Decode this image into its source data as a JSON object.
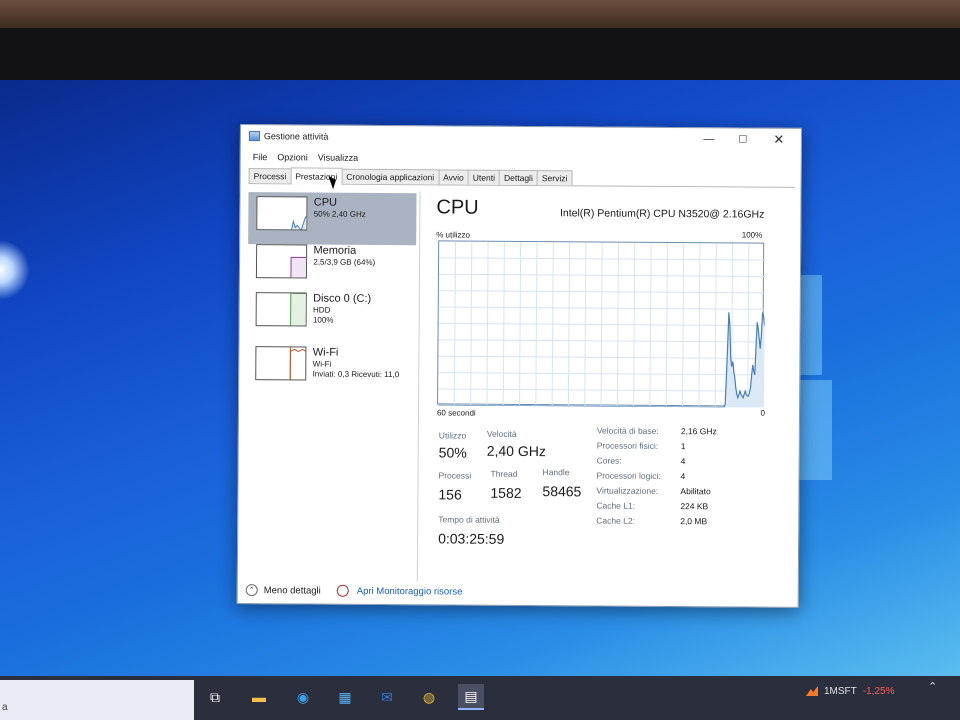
{
  "window": {
    "title": "Gestione attività"
  },
  "menu": [
    "File",
    "Opzioni",
    "Visualizza"
  ],
  "tabs": [
    "Processi",
    "Prestazioni",
    "Cronologia applicazioni",
    "Avvio",
    "Utenti",
    "Dettagli",
    "Servizi"
  ],
  "active_tab": "Prestazioni",
  "resources": [
    {
      "name": "CPU",
      "line1": "50% 2,40 GHz",
      "line2": ""
    },
    {
      "name": "Memoria",
      "line1": "2,5/3,9 GB (64%)",
      "line2": ""
    },
    {
      "name": "Disco 0 (C:)",
      "line1": "HDD",
      "line2": "100%"
    },
    {
      "name": "Wi-Fi",
      "line1": "Wi-Fi",
      "line2": "Inviati: 0,3 Ricevuti: 11,0"
    }
  ],
  "cpu": {
    "title": "CPU",
    "model": "Intel(R) Pentium(R) CPU N3520@ 2.16GHz",
    "util_label": "% utilizzo",
    "max_label": "100%",
    "time_label": "60 secondi",
    "min_label": "0",
    "history_percent": [
      0,
      0,
      0,
      0,
      0,
      0,
      0,
      0,
      0,
      0,
      0,
      0,
      0,
      0,
      0,
      0,
      0,
      0,
      0,
      0,
      0,
      0,
      0,
      0,
      0,
      0,
      0,
      0,
      0,
      0,
      0,
      0,
      0,
      0,
      0,
      0,
      0,
      0,
      0,
      0,
      0,
      0,
      0,
      0,
      0,
      0,
      0,
      0,
      0,
      0,
      0,
      0,
      0,
      0,
      0,
      0,
      0,
      0,
      0,
      0,
      0,
      0,
      0,
      0,
      0,
      0,
      0,
      0,
      0,
      0,
      0,
      0,
      0,
      0,
      0,
      0,
      0,
      0,
      0,
      0,
      0,
      0,
      0,
      0,
      0,
      0,
      0,
      0,
      0,
      0,
      0,
      0,
      0,
      0,
      0,
      0,
      0,
      0,
      0,
      0,
      0,
      0,
      0,
      0,
      0,
      0,
      0,
      0,
      0,
      0,
      0,
      0,
      0,
      0,
      0,
      0,
      0,
      0,
      0,
      0,
      0,
      0,
      0,
      0,
      0,
      0,
      0,
      0,
      0,
      0,
      0,
      0,
      0,
      0,
      0,
      0,
      0,
      0,
      0,
      0,
      0,
      0,
      0,
      0,
      0,
      0,
      0,
      0,
      0,
      0,
      0,
      0,
      0,
      0,
      0,
      0,
      0,
      0,
      0,
      0,
      0,
      0,
      0,
      0,
      0,
      0,
      0,
      0,
      0,
      0,
      0,
      0,
      0,
      0,
      0,
      0,
      0,
      0,
      0,
      0,
      0,
      0,
      0,
      0,
      0,
      0,
      0,
      0,
      0,
      0,
      0,
      0,
      0,
      0,
      0,
      0,
      0,
      0,
      0,
      0,
      0,
      0,
      0,
      0,
      0,
      0,
      0,
      0,
      0,
      0,
      0,
      0,
      0,
      0,
      0,
      0,
      0,
      0,
      0,
      0,
      0,
      0,
      0,
      0,
      0,
      0,
      0,
      0,
      0,
      0,
      0,
      0,
      0,
      0,
      0,
      0,
      0,
      0,
      0,
      0,
      0,
      0,
      0,
      0,
      0,
      0,
      0,
      0,
      0,
      0,
      0,
      0,
      0,
      0,
      0,
      0,
      0,
      0,
      0,
      0,
      0,
      0,
      0,
      0,
      0,
      0,
      0,
      0,
      0,
      0,
      0,
      0,
      0,
      2,
      18,
      38,
      58,
      50,
      30,
      25,
      28,
      22,
      18,
      12,
      8,
      6,
      8,
      10,
      8,
      7,
      6,
      8,
      10,
      8,
      7,
      7,
      9,
      12,
      20,
      26,
      22,
      20,
      38,
      52,
      48,
      42,
      36,
      44,
      58,
      56,
      50
    ],
    "stats": {
      "utilizzo": {
        "label": "Utilizzo",
        "value": "50%"
      },
      "velocita": {
        "label": "Velocità",
        "value": "2,40 GHz"
      },
      "processi": {
        "label": "Processi",
        "value": "156"
      },
      "thread": {
        "label": "Thread",
        "value": "1582"
      },
      "handle": {
        "label": "Handle",
        "value": "58465"
      },
      "tempo": {
        "label": "Tempo di attività",
        "value": "0:03:25:59"
      }
    },
    "details": [
      {
        "key": "Velocità di base:",
        "value": "2,16 GHz"
      },
      {
        "key": "Processori fisici:",
        "value": "1"
      },
      {
        "key": "Cores:",
        "value": "4"
      },
      {
        "key": "Processori logici:",
        "value": "4"
      },
      {
        "key": "Virtualizzazione:",
        "value": "Abilitato"
      },
      {
        "key": "Cache L1:",
        "value": "224 KB"
      },
      {
        "key": "Cache L2:",
        "value": "2,0 MB"
      }
    ]
  },
  "footer": {
    "fewer_details": "Meno dettagli",
    "resource_monitor": "Apri Monitoraggio risorse"
  },
  "taskbar": {
    "search_partial": "a",
    "stock_ticker": "1MSFT",
    "stock_change": "-1,25%"
  },
  "colors": {
    "graph_line": "#4a7eb4",
    "graph_grid": "#d6e4f1",
    "selected_resource": "#a9b3c2"
  }
}
